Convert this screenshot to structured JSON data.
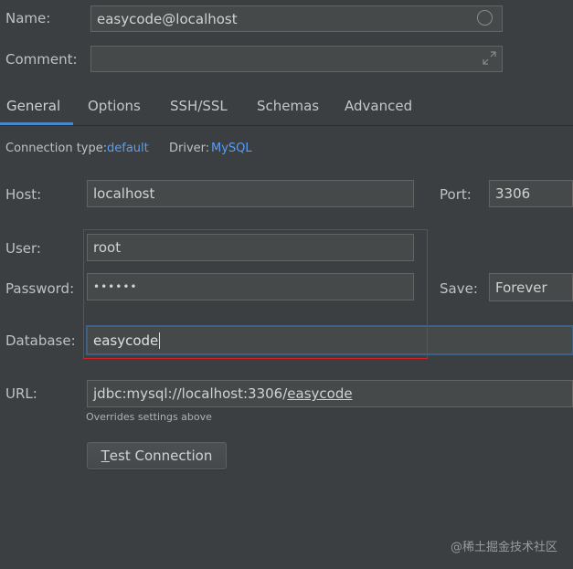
{
  "name": {
    "label": "Name:",
    "value": "easycode@localhost"
  },
  "comment": {
    "label": "Comment:",
    "value": ""
  },
  "tabs": [
    {
      "label": "General"
    },
    {
      "label": "Options"
    },
    {
      "label": "SSH/SSL"
    },
    {
      "label": "Schemas"
    },
    {
      "label": "Advanced"
    }
  ],
  "connection": {
    "type_label": "Connection type:",
    "type_value": "default",
    "driver_label": "Driver:",
    "driver_value": "MySQL"
  },
  "host": {
    "label": "Host:",
    "value": "localhost"
  },
  "port": {
    "label": "Port:",
    "value": "3306"
  },
  "user": {
    "label": "User:",
    "value": "root"
  },
  "password": {
    "label": "Password:",
    "value": "••••••"
  },
  "save": {
    "label": "Save:",
    "value": "Forever"
  },
  "database": {
    "label": "Database:",
    "value": "easycode"
  },
  "url": {
    "label": "URL:",
    "prefix": "jdbc:mysql://localhost:3306/",
    "db": "easycode",
    "hint": "Overrides settings above"
  },
  "test_button": {
    "mnemonic": "T",
    "rest": "est Connection"
  },
  "watermark": "@稀土掘金技术社区",
  "colors": {
    "accent": "#589df6",
    "highlight_box": "#d32020",
    "focus": "#3d6185"
  }
}
